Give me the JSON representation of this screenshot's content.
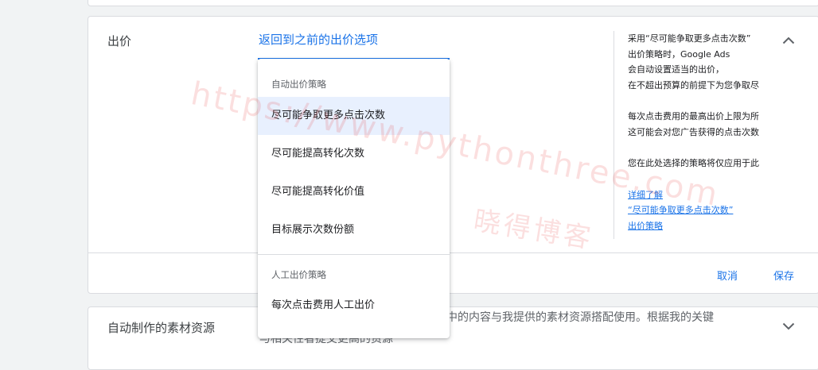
{
  "bidding": {
    "section_title": "出价",
    "back_link": "返回到之前的出价选项",
    "dropdown": {
      "group_auto_label": "自动出价策略",
      "auto_options": [
        "尽可能争取更多点击次数",
        "尽可能提高转化次数",
        "尽可能提高转化价值",
        "目标展示次数份额"
      ],
      "selected_index": 0,
      "group_manual_label": "人工出价策略",
      "manual_options": [
        "每次点击费用人工出价"
      ]
    },
    "help": {
      "paragraph1": [
        "采用“尽可能争取更多点击次数”",
        "出价策略时，Google Ads",
        "会自动设置适当的出价，",
        "在不超出预算的前提下为您争取尽"
      ],
      "paragraph2": [
        "每次点击费用的最高出价上限为所",
        "这可能会对您广告获得的点击次数"
      ],
      "paragraph3": [
        "您在此处选择的策略将仅应用于此"
      ],
      "learn_more_links": [
        "详细了解",
        "“尽可能争取更多点击次数”",
        "出价策略"
      ]
    },
    "cancel_label": "取消",
    "save_label": "保存"
  },
  "assets": {
    "section_title": "自动制作的素材资源",
    "description_line1": "中的内容与我提供的素材资源搭配使用。根据我的关键",
    "description_line2": "与相关性者提交更高的资源"
  },
  "watermark": {
    "url_text": "https://www.pythonthree.com",
    "cn_text": "晓得博客"
  },
  "colors": {
    "accent": "#1a73e8",
    "selected_bg": "#e8f0fe",
    "border": "#dadce0",
    "page_bg": "#f1f3f4",
    "watermark": "#e53935"
  },
  "icons": {
    "collapse": "chevron-up-icon",
    "expand": "chevron-down-icon"
  }
}
